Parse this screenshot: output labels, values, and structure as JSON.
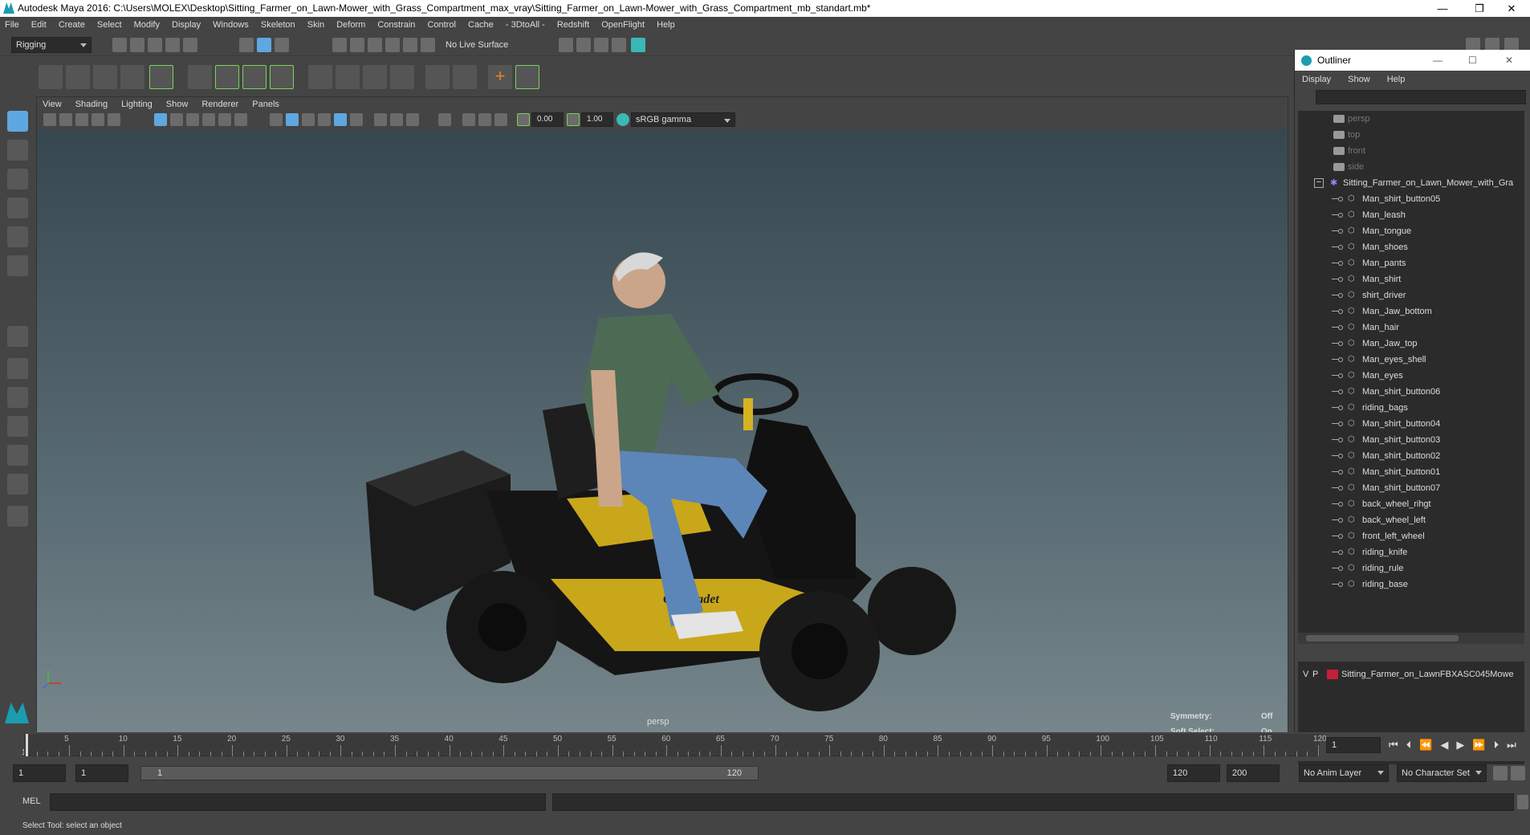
{
  "window": {
    "title": "Autodesk Maya 2016: C:\\Users\\MOLEX\\Desktop\\Sitting_Farmer_on_Lawn-Mower_with_Grass_Compartment_max_vray\\Sitting_Farmer_on_Lawn-Mower_with_Grass_Compartment_mb_standart.mb*",
    "minimize": "—",
    "restore": "❐",
    "close": "✕"
  },
  "menu": [
    "File",
    "Edit",
    "Create",
    "Select",
    "Modify",
    "Display",
    "Windows",
    "Skeleton",
    "Skin",
    "Deform",
    "Constrain",
    "Control",
    "Cache",
    "- 3DtoAll -",
    "Redshift",
    "OpenFlight",
    "Help"
  ],
  "shelf": {
    "mode": "Rigging",
    "live_surface": "No Live Surface"
  },
  "viewport": {
    "menu": [
      "View",
      "Shading",
      "Lighting",
      "Show",
      "Renderer",
      "Panels"
    ],
    "exposure": "0.00",
    "gamma": "1.00",
    "color_space": "sRGB gamma",
    "camera_label": "persp",
    "symmetry_label": "Symmetry:",
    "symmetry_value": "Off",
    "soft_select_label": "Soft Select:",
    "soft_select_value": "On",
    "decal_text": "Cub Cadet"
  },
  "outliner": {
    "title": "Outliner",
    "menu": [
      "Display",
      "Show",
      "Help"
    ],
    "cameras": [
      "persp",
      "top",
      "front",
      "side"
    ],
    "root": "Sitting_Farmer_on_Lawn_Mower_with_Gra",
    "children": [
      "Man_shirt_button05",
      "Man_leash",
      "Man_tongue",
      "Man_shoes",
      "Man_pants",
      "Man_shirt",
      "shirt_driver",
      "Man_Jaw_bottom",
      "Man_hair",
      "Man_Jaw_top",
      "Man_eyes_shell",
      "Man_eyes",
      "Man_shirt_button06",
      "riding_bags",
      "Man_shirt_button04",
      "Man_shirt_button03",
      "Man_shirt_button02",
      "Man_shirt_button01",
      "Man_shirt_button07",
      "back_wheel_rihgt",
      "back_wheel_left",
      "front_left_wheel",
      "riding_knife",
      "riding_rule",
      "riding_base"
    ],
    "layer": {
      "v": "V",
      "p": "P",
      "name": "Sitting_Farmer_on_LawnFBXASC045Mowe",
      "color": "#c0203a"
    }
  },
  "timeline": {
    "labels": [
      "5",
      "10",
      "15",
      "20",
      "25",
      "30",
      "35",
      "40",
      "45",
      "50",
      "55",
      "60",
      "65",
      "70",
      "75",
      "80",
      "85",
      "90",
      "95",
      "100",
      "105",
      "110",
      "115",
      "120"
    ],
    "start_label": "1",
    "current_frame": "1"
  },
  "range": {
    "start": "1",
    "playback_start": "1",
    "slider_start": "1",
    "slider_end": "120",
    "playback_end": "120",
    "end": "200",
    "anim_layer": "No Anim Layer",
    "character_set": "No Character Set"
  },
  "command": {
    "lang": "MEL"
  },
  "status": "Select Tool: select an object"
}
